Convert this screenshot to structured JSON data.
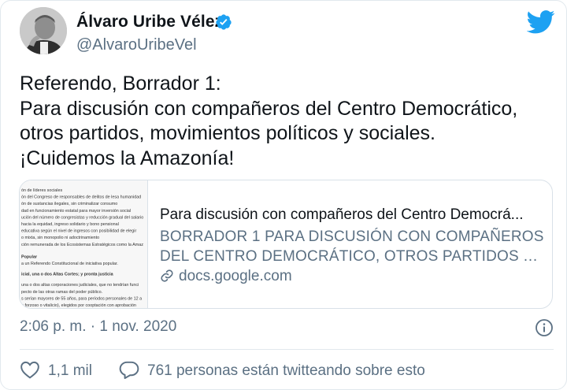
{
  "tweet": {
    "author_name": "Álvaro Uribe Vélez",
    "handle": "@AlvaroUribeVel",
    "text": "Referendo, Borrador 1:\nPara discusión con compañeros del Centro Democrático, otros partidos, movimientos políticos y sociales.\n¡Cuidemos la Amazonía!",
    "timestamp": "2:06 p. m. · 1 nov. 2020",
    "likes": "1,1 mil",
    "conversation": "761 personas están twitteando sobre esto"
  },
  "link_card": {
    "title": "Para discusión con compañeros del Centro Democrá...",
    "description_line1": "BORRADOR 1 PARA DISCUSIÓN CON COMPAÑEROS",
    "description_line2": "DEL CENTRO DEMOCRÁTICO, OTROS PARTIDOS Y ...",
    "domain": "docs.google.com",
    "thumbnail_lines": [
      "ón de líderes sociales",
      "ón del Congreso de responsables de delitos de lesa humanidad",
      "ón de sustancias ilegales, sin criminalizar consumo",
      "dad en funcionamiento estatal para mayor inversión social",
      "ución del número de congresistas y reducción gradual del salario",
      "hacia la equidad, ingreso solidario y bono pensional",
      "educativa según el nivel de ingresos con posibilidad de elegir",
      "o mixta, sin monopolio ni adoctrinamiento",
      "ción remunerada de los Ecosistemas Estratégicos como la Amaz",
      "Popular",
      "a un Referendo Constitucional de iniciativa popular.",
      "icial, una o dos Altas Cortes; y pronta justicia",
      "una o dos altas corporaciones judiciales, que no tendrían funci",
      "pecto de las otras ramas del poder público.",
      "s serían mayores de 55 años, para períodos personales de 12 a",
      "o forzoso o vitalicio), elegidos por cooptación con aprobación"
    ]
  },
  "icons": {
    "verified": "verified-badge-icon",
    "brand": "twitter-bird-icon",
    "info": "info-icon",
    "like": "heart-icon",
    "conversation": "speech-bubble-icon",
    "link": "link-icon"
  },
  "colors": {
    "brand_blue": "#1da1f2",
    "secondary_text": "#5b7083",
    "primary_text": "#0f1419",
    "border": "#e1e8ed"
  }
}
